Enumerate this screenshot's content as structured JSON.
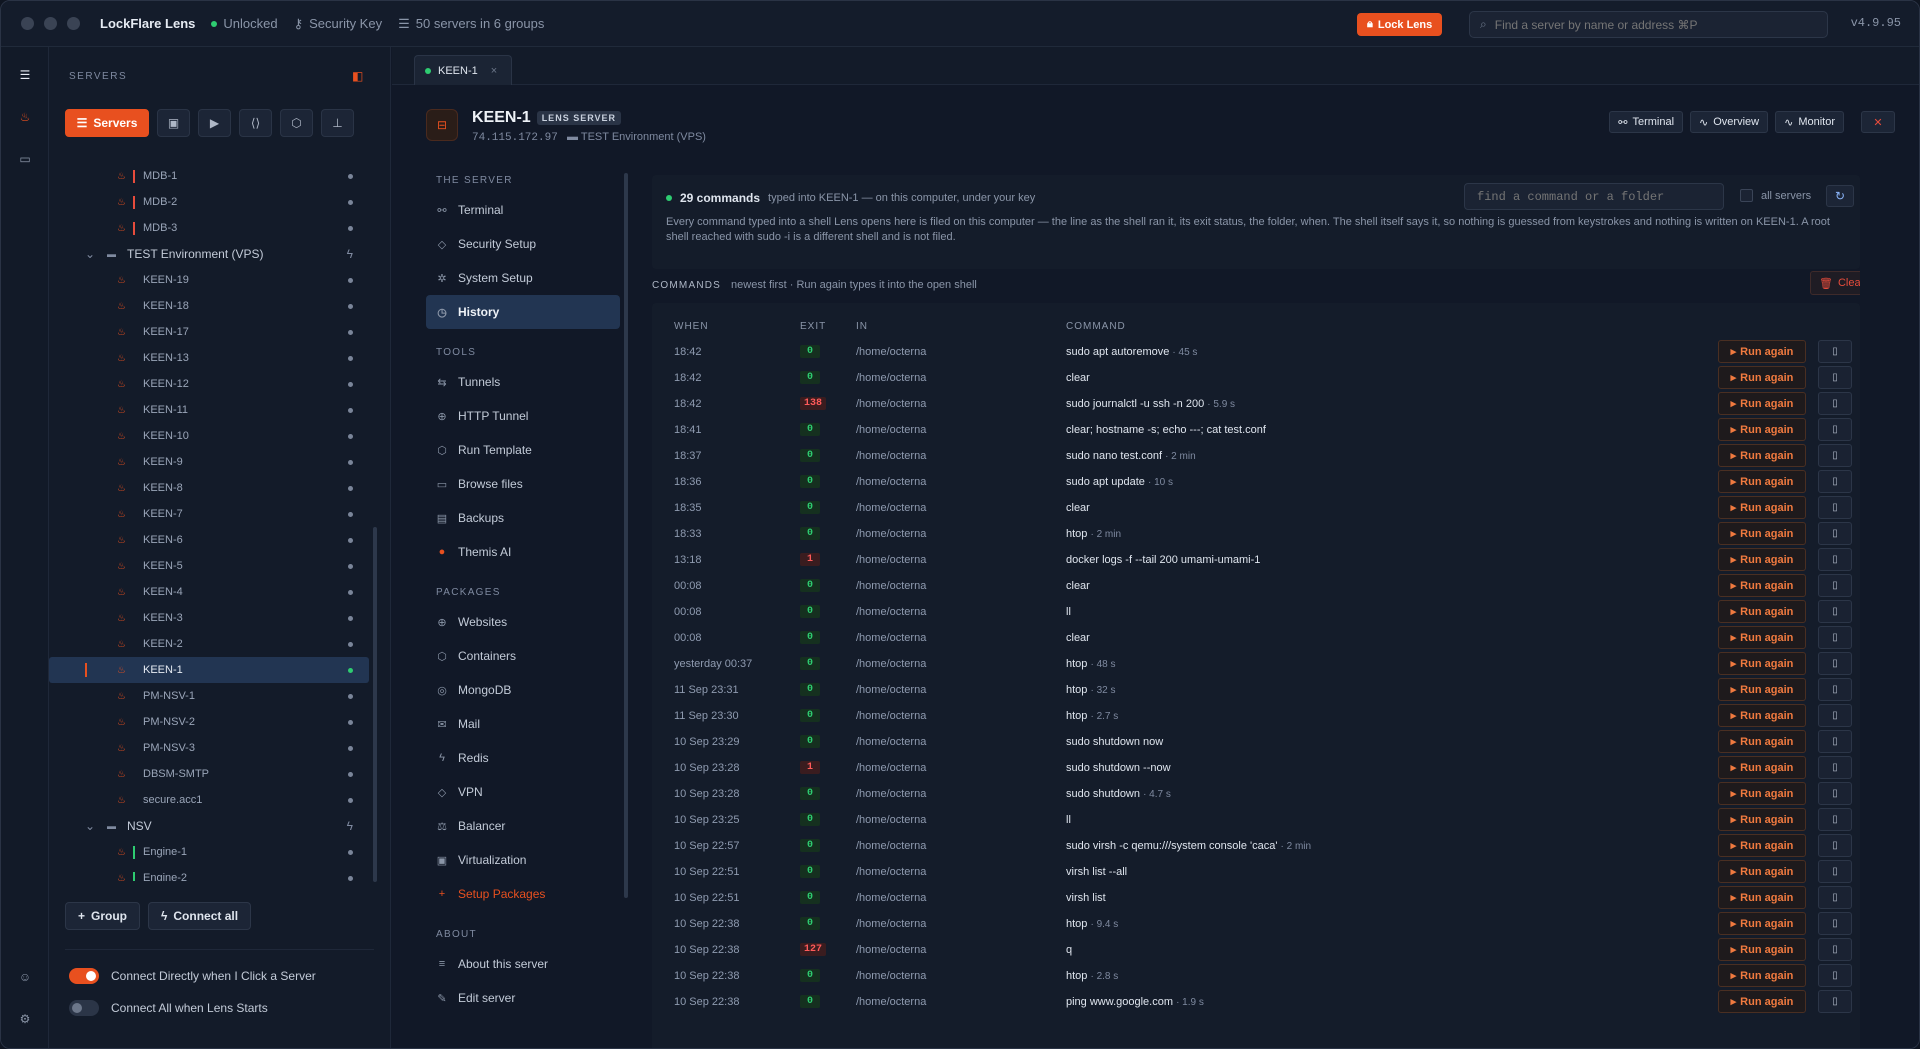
{
  "titlebar": {
    "app_name": "LockFlare Lens",
    "status": "Unlocked",
    "key": "Security Key",
    "servers_summary": "50 servers in 6 groups",
    "lock_label": "Lock Lens",
    "search_placeholder": "Find a server by name or address ⌘P",
    "version": "v4.9.95"
  },
  "sidebar": {
    "title": "SERVERS",
    "active_tab": "Servers",
    "tree": [
      {
        "type": "server",
        "name": "MDB-1",
        "bar": "red"
      },
      {
        "type": "server",
        "name": "MDB-2",
        "bar": "red"
      },
      {
        "type": "server",
        "name": "MDB-3",
        "bar": "red"
      },
      {
        "type": "group",
        "name": "TEST Environment (VPS)"
      },
      {
        "type": "server",
        "name": "KEEN-19"
      },
      {
        "type": "server",
        "name": "KEEN-18"
      },
      {
        "type": "server",
        "name": "KEEN-17"
      },
      {
        "type": "server",
        "name": "KEEN-13"
      },
      {
        "type": "server",
        "name": "KEEN-12"
      },
      {
        "type": "server",
        "name": "KEEN-11"
      },
      {
        "type": "server",
        "name": "KEEN-10"
      },
      {
        "type": "server",
        "name": "KEEN-9"
      },
      {
        "type": "server",
        "name": "KEEN-8"
      },
      {
        "type": "server",
        "name": "KEEN-7"
      },
      {
        "type": "server",
        "name": "KEEN-6"
      },
      {
        "type": "server",
        "name": "KEEN-5"
      },
      {
        "type": "server",
        "name": "KEEN-4"
      },
      {
        "type": "server",
        "name": "KEEN-3"
      },
      {
        "type": "server",
        "name": "KEEN-2"
      },
      {
        "type": "server",
        "name": "KEEN-1",
        "selected": true
      },
      {
        "type": "server",
        "name": "PM-NSV-1"
      },
      {
        "type": "server",
        "name": "PM-NSV-2"
      },
      {
        "type": "server",
        "name": "PM-NSV-3"
      },
      {
        "type": "server",
        "name": "DBSM-SMTP"
      },
      {
        "type": "server",
        "name": "secure.acc1"
      },
      {
        "type": "group",
        "name": "NSV"
      },
      {
        "type": "server",
        "name": "Engine-1",
        "bar": "green"
      },
      {
        "type": "server",
        "name": "Engine-2",
        "bar": "green"
      }
    ],
    "group_btn": "Group",
    "connect_all_btn": "Connect all",
    "toggle_connect_direct": "Connect Directly when I Click a Server",
    "toggle_connect_start": "Connect All when Lens Starts"
  },
  "tab": {
    "label": "KEEN-1"
  },
  "server": {
    "name": "KEEN-1",
    "badge": "LENS SERVER",
    "ip": "74.115.172.97",
    "group": "TEST Environment (VPS)",
    "btn_terminal": "Terminal",
    "btn_overview": "Overview",
    "btn_monitor": "Monitor"
  },
  "nav": {
    "sec_server": "THE SERVER",
    "server_items": [
      {
        "icon": "terminal-icon",
        "glyph": "⚯",
        "label": "Terminal"
      },
      {
        "icon": "shield-icon",
        "glyph": "◇",
        "label": "Security Setup"
      },
      {
        "icon": "gear-icon",
        "glyph": "✲",
        "label": "System Setup"
      },
      {
        "icon": "clock-icon",
        "glyph": "◷",
        "label": "History",
        "active": true
      }
    ],
    "sec_tools": "TOOLS",
    "tool_items": [
      {
        "icon": "tunnel-icon",
        "glyph": "⇆",
        "label": "Tunnels"
      },
      {
        "icon": "globe-icon",
        "glyph": "⊕",
        "label": "HTTP Tunnel"
      },
      {
        "icon": "cube-icon",
        "glyph": "⬡",
        "label": "Run Template"
      },
      {
        "icon": "folder-icon",
        "glyph": "▭",
        "label": "Browse files"
      },
      {
        "icon": "backup-icon",
        "glyph": "▤",
        "label": "Backups"
      },
      {
        "icon": "ai-icon",
        "glyph": "●",
        "label": "Themis AI"
      }
    ],
    "sec_packages": "PACKAGES",
    "package_items": [
      {
        "icon": "globe-icon",
        "glyph": "⊕",
        "label": "Websites"
      },
      {
        "icon": "container-icon",
        "glyph": "⬡",
        "label": "Containers"
      },
      {
        "icon": "database-icon",
        "glyph": "◎",
        "label": "MongoDB"
      },
      {
        "icon": "mail-icon",
        "glyph": "✉",
        "label": "Mail"
      },
      {
        "icon": "bolt-icon",
        "glyph": "ϟ",
        "label": "Redis"
      },
      {
        "icon": "vpn-icon",
        "glyph": "◇",
        "label": "VPN"
      },
      {
        "icon": "balancer-icon",
        "glyph": "⚖",
        "label": "Balancer"
      },
      {
        "icon": "virtualization-icon",
        "glyph": "▣",
        "label": "Virtualization"
      },
      {
        "icon": "plus-icon",
        "glyph": "+",
        "label": "Setup Packages",
        "accent": true
      }
    ],
    "sec_about": "ABOUT",
    "about_items": [
      {
        "icon": "list-icon",
        "glyph": "≡",
        "label": "About this server"
      },
      {
        "icon": "edit-icon",
        "glyph": "✎",
        "label": "Edit server"
      }
    ]
  },
  "history": {
    "count": "29 commands",
    "count_sub": "typed into KEEN-1 — on this computer, under your key",
    "explain": "Every command typed into a shell Lens opens here is filed on this computer — the line as the shell ran it, its exit status, the folder, when. The shell itself says it, so nothing is guessed from keystrokes and nothing is written on KEEN-1. A root shell reached with sudo -i is a different shell and is not filed.",
    "find_placeholder": "find a command or a folder",
    "all_servers": "all servers",
    "section_title": "COMMANDS",
    "section_sub": "newest first · Run again types it into the open shell",
    "clear_label": "Clear",
    "col_when": "WHEN",
    "col_exit": "EXIT",
    "col_in": "IN",
    "col_command": "COMMAND",
    "run_label": "Run again",
    "rows": [
      {
        "when": "18:42",
        "exit": "0",
        "in": "/home/octerna",
        "cmd": "sudo apt autoremove",
        "dur": "· 45 s"
      },
      {
        "when": "18:42",
        "exit": "0",
        "in": "/home/octerna",
        "cmd": "clear",
        "dur": ""
      },
      {
        "when": "18:42",
        "exit": "138",
        "in": "/home/octerna",
        "cmd": "sudo journalctl -u ssh -n 200",
        "dur": "· 5.9 s"
      },
      {
        "when": "18:41",
        "exit": "0",
        "in": "/home/octerna",
        "cmd": "clear; hostname -s; echo ---; cat test.conf",
        "dur": ""
      },
      {
        "when": "18:37",
        "exit": "0",
        "in": "/home/octerna",
        "cmd": "sudo nano test.conf",
        "dur": "· 2 min"
      },
      {
        "when": "18:36",
        "exit": "0",
        "in": "/home/octerna",
        "cmd": "sudo apt update",
        "dur": "· 10 s"
      },
      {
        "when": "18:35",
        "exit": "0",
        "in": "/home/octerna",
        "cmd": "clear",
        "dur": ""
      },
      {
        "when": "18:33",
        "exit": "0",
        "in": "/home/octerna",
        "cmd": "htop",
        "dur": "· 2 min"
      },
      {
        "when": "13:18",
        "exit": "1",
        "in": "/home/octerna",
        "cmd": "docker logs -f --tail 200 umami-umami-1",
        "dur": ""
      },
      {
        "when": "00:08",
        "exit": "0",
        "in": "/home/octerna",
        "cmd": "clear",
        "dur": ""
      },
      {
        "when": "00:08",
        "exit": "0",
        "in": "/home/octerna",
        "cmd": "ll",
        "dur": ""
      },
      {
        "when": "00:08",
        "exit": "0",
        "in": "/home/octerna",
        "cmd": "clear",
        "dur": ""
      },
      {
        "when": "yesterday 00:37",
        "exit": "0",
        "in": "/home/octerna",
        "cmd": "htop",
        "dur": "· 48 s"
      },
      {
        "when": "11 Sep 23:31",
        "exit": "0",
        "in": "/home/octerna",
        "cmd": "htop",
        "dur": "· 32 s"
      },
      {
        "when": "11 Sep 23:30",
        "exit": "0",
        "in": "/home/octerna",
        "cmd": "htop",
        "dur": "· 2.7 s"
      },
      {
        "when": "10 Sep 23:29",
        "exit": "0",
        "in": "/home/octerna",
        "cmd": "sudo shutdown now",
        "dur": ""
      },
      {
        "when": "10 Sep 23:28",
        "exit": "1",
        "in": "/home/octerna",
        "cmd": "sudo shutdown --now",
        "dur": ""
      },
      {
        "when": "10 Sep 23:28",
        "exit": "0",
        "in": "/home/octerna",
        "cmd": "sudo shutdown",
        "dur": "· 4.7 s"
      },
      {
        "when": "10 Sep 23:25",
        "exit": "0",
        "in": "/home/octerna",
        "cmd": "ll",
        "dur": ""
      },
      {
        "when": "10 Sep 22:57",
        "exit": "0",
        "in": "/home/octerna",
        "cmd": "sudo virsh -c qemu:///system console 'caca'",
        "dur": "· 2 min"
      },
      {
        "when": "10 Sep 22:51",
        "exit": "0",
        "in": "/home/octerna",
        "cmd": "virsh list --all",
        "dur": ""
      },
      {
        "when": "10 Sep 22:51",
        "exit": "0",
        "in": "/home/octerna",
        "cmd": "virsh list",
        "dur": ""
      },
      {
        "when": "10 Sep 22:38",
        "exit": "0",
        "in": "/home/octerna",
        "cmd": "htop",
        "dur": "· 9.4 s"
      },
      {
        "when": "10 Sep 22:38",
        "exit": "127",
        "in": "/home/octerna",
        "cmd": "q",
        "dur": ""
      },
      {
        "when": "10 Sep 22:38",
        "exit": "0",
        "in": "/home/octerna",
        "cmd": "htop",
        "dur": "· 2.8 s"
      },
      {
        "when": "10 Sep 22:38",
        "exit": "0",
        "in": "/home/octerna",
        "cmd": "ping www.google.com",
        "dur": "· 1.9 s"
      }
    ]
  },
  "colors": {
    "accent": "#e8501f",
    "ok": "#2ecc71",
    "error": "#ff5a5a",
    "selected": "#223552"
  }
}
